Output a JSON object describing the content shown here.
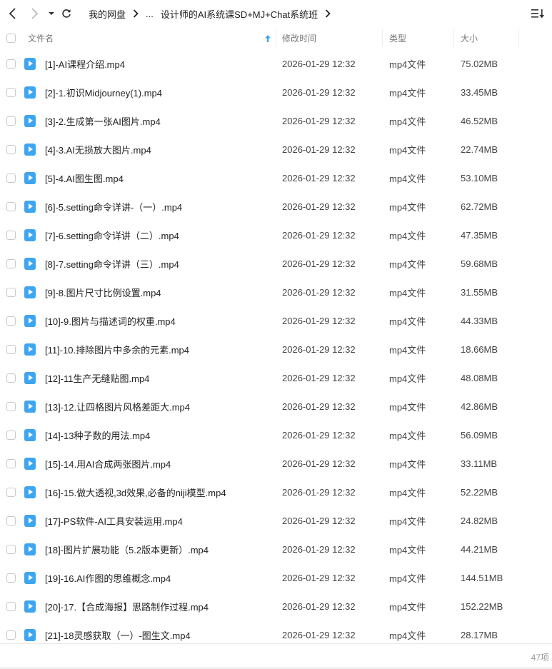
{
  "toolbar": {
    "back_icon": "chevron-left-icon",
    "forward_icon": "chevron-right-icon",
    "history_icon": "caret-down-icon",
    "refresh_icon": "refresh-icon",
    "sort_icon": "sort-list-icon"
  },
  "breadcrumb": {
    "root": "我的网盘",
    "ellipsis": "...",
    "current": "设计师的AI系统课SD+MJ+Chat系统班"
  },
  "columns": {
    "name": "文件名",
    "modified": "修改时间",
    "type": "类型",
    "size": "大小"
  },
  "sort": {
    "column": "name",
    "direction": "ascending"
  },
  "files": [
    {
      "name": "[1]-AI课程介绍.mp4",
      "modified": "2026-01-29 12:32",
      "type": "mp4文件",
      "size": "75.02MB"
    },
    {
      "name": "[2]-1.初识Midjourney(1).mp4",
      "modified": "2026-01-29 12:32",
      "type": "mp4文件",
      "size": "33.45MB"
    },
    {
      "name": "[3]-2.生成第一张AI图片.mp4",
      "modified": "2026-01-29 12:32",
      "type": "mp4文件",
      "size": "46.52MB"
    },
    {
      "name": "[4]-3.AI无损放大图片.mp4",
      "modified": "2026-01-29 12:32",
      "type": "mp4文件",
      "size": "22.74MB"
    },
    {
      "name": "[5]-4.AI图生图.mp4",
      "modified": "2026-01-29 12:32",
      "type": "mp4文件",
      "size": "53.10MB"
    },
    {
      "name": "[6]-5.setting命令详讲-（一）.mp4",
      "modified": "2026-01-29 12:32",
      "type": "mp4文件",
      "size": "62.72MB"
    },
    {
      "name": "[7]-6.setting命令详讲（二）.mp4",
      "modified": "2026-01-29 12:32",
      "type": "mp4文件",
      "size": "47.35MB"
    },
    {
      "name": "[8]-7.setting命令详讲（三）.mp4",
      "modified": "2026-01-29 12:32",
      "type": "mp4文件",
      "size": "59.68MB"
    },
    {
      "name": "[9]-8.图片尺寸比例设置.mp4",
      "modified": "2026-01-29 12:32",
      "type": "mp4文件",
      "size": "31.55MB"
    },
    {
      "name": "[10]-9.图片与描述词的权重.mp4",
      "modified": "2026-01-29 12:32",
      "type": "mp4文件",
      "size": "44.33MB"
    },
    {
      "name": "[11]-10.排除图片中多余的元素.mp4",
      "modified": "2026-01-29 12:32",
      "type": "mp4文件",
      "size": "18.66MB"
    },
    {
      "name": "[12]-11生产无缝贴图.mp4",
      "modified": "2026-01-29 12:32",
      "type": "mp4文件",
      "size": "48.08MB"
    },
    {
      "name": "[13]-12.让四格图片风格差距大.mp4",
      "modified": "2026-01-29 12:32",
      "type": "mp4文件",
      "size": "42.86MB"
    },
    {
      "name": "[14]-13种子数的用法.mp4",
      "modified": "2026-01-29 12:32",
      "type": "mp4文件",
      "size": "56.09MB"
    },
    {
      "name": "[15]-14.用AI合成两张图片.mp4",
      "modified": "2026-01-29 12:32",
      "type": "mp4文件",
      "size": "33.11MB"
    },
    {
      "name": "[16]-15.做大透视,3d效果,必备的niji模型.mp4",
      "modified": "2026-01-29 12:32",
      "type": "mp4文件",
      "size": "52.22MB"
    },
    {
      "name": "[17]-PS软件-AI工具安装运用.mp4",
      "modified": "2026-01-29 12:32",
      "type": "mp4文件",
      "size": "24.82MB"
    },
    {
      "name": "[18]-图片扩展功能（5.2版本更新）.mp4",
      "modified": "2026-01-29 12:32",
      "type": "mp4文件",
      "size": "44.21MB"
    },
    {
      "name": "[19]-16.AI作图的思维概念.mp4",
      "modified": "2026-01-29 12:32",
      "type": "mp4文件",
      "size": "144.51MB"
    },
    {
      "name": "[20]-17.【合成海报】思路制作过程.mp4",
      "modified": "2026-01-29 12:32",
      "type": "mp4文件",
      "size": "152.22MB"
    },
    {
      "name": "[21]-18灵感获取（一）-图生文.mp4",
      "modified": "2026-01-29 12:32",
      "type": "mp4文件",
      "size": "28.17MB"
    }
  ],
  "file_icon": "video-file-icon",
  "status": {
    "item_count": "47项"
  },
  "colors": {
    "file_icon": "#3ea5f0",
    "sort_arrow": "#3ea5f0"
  }
}
